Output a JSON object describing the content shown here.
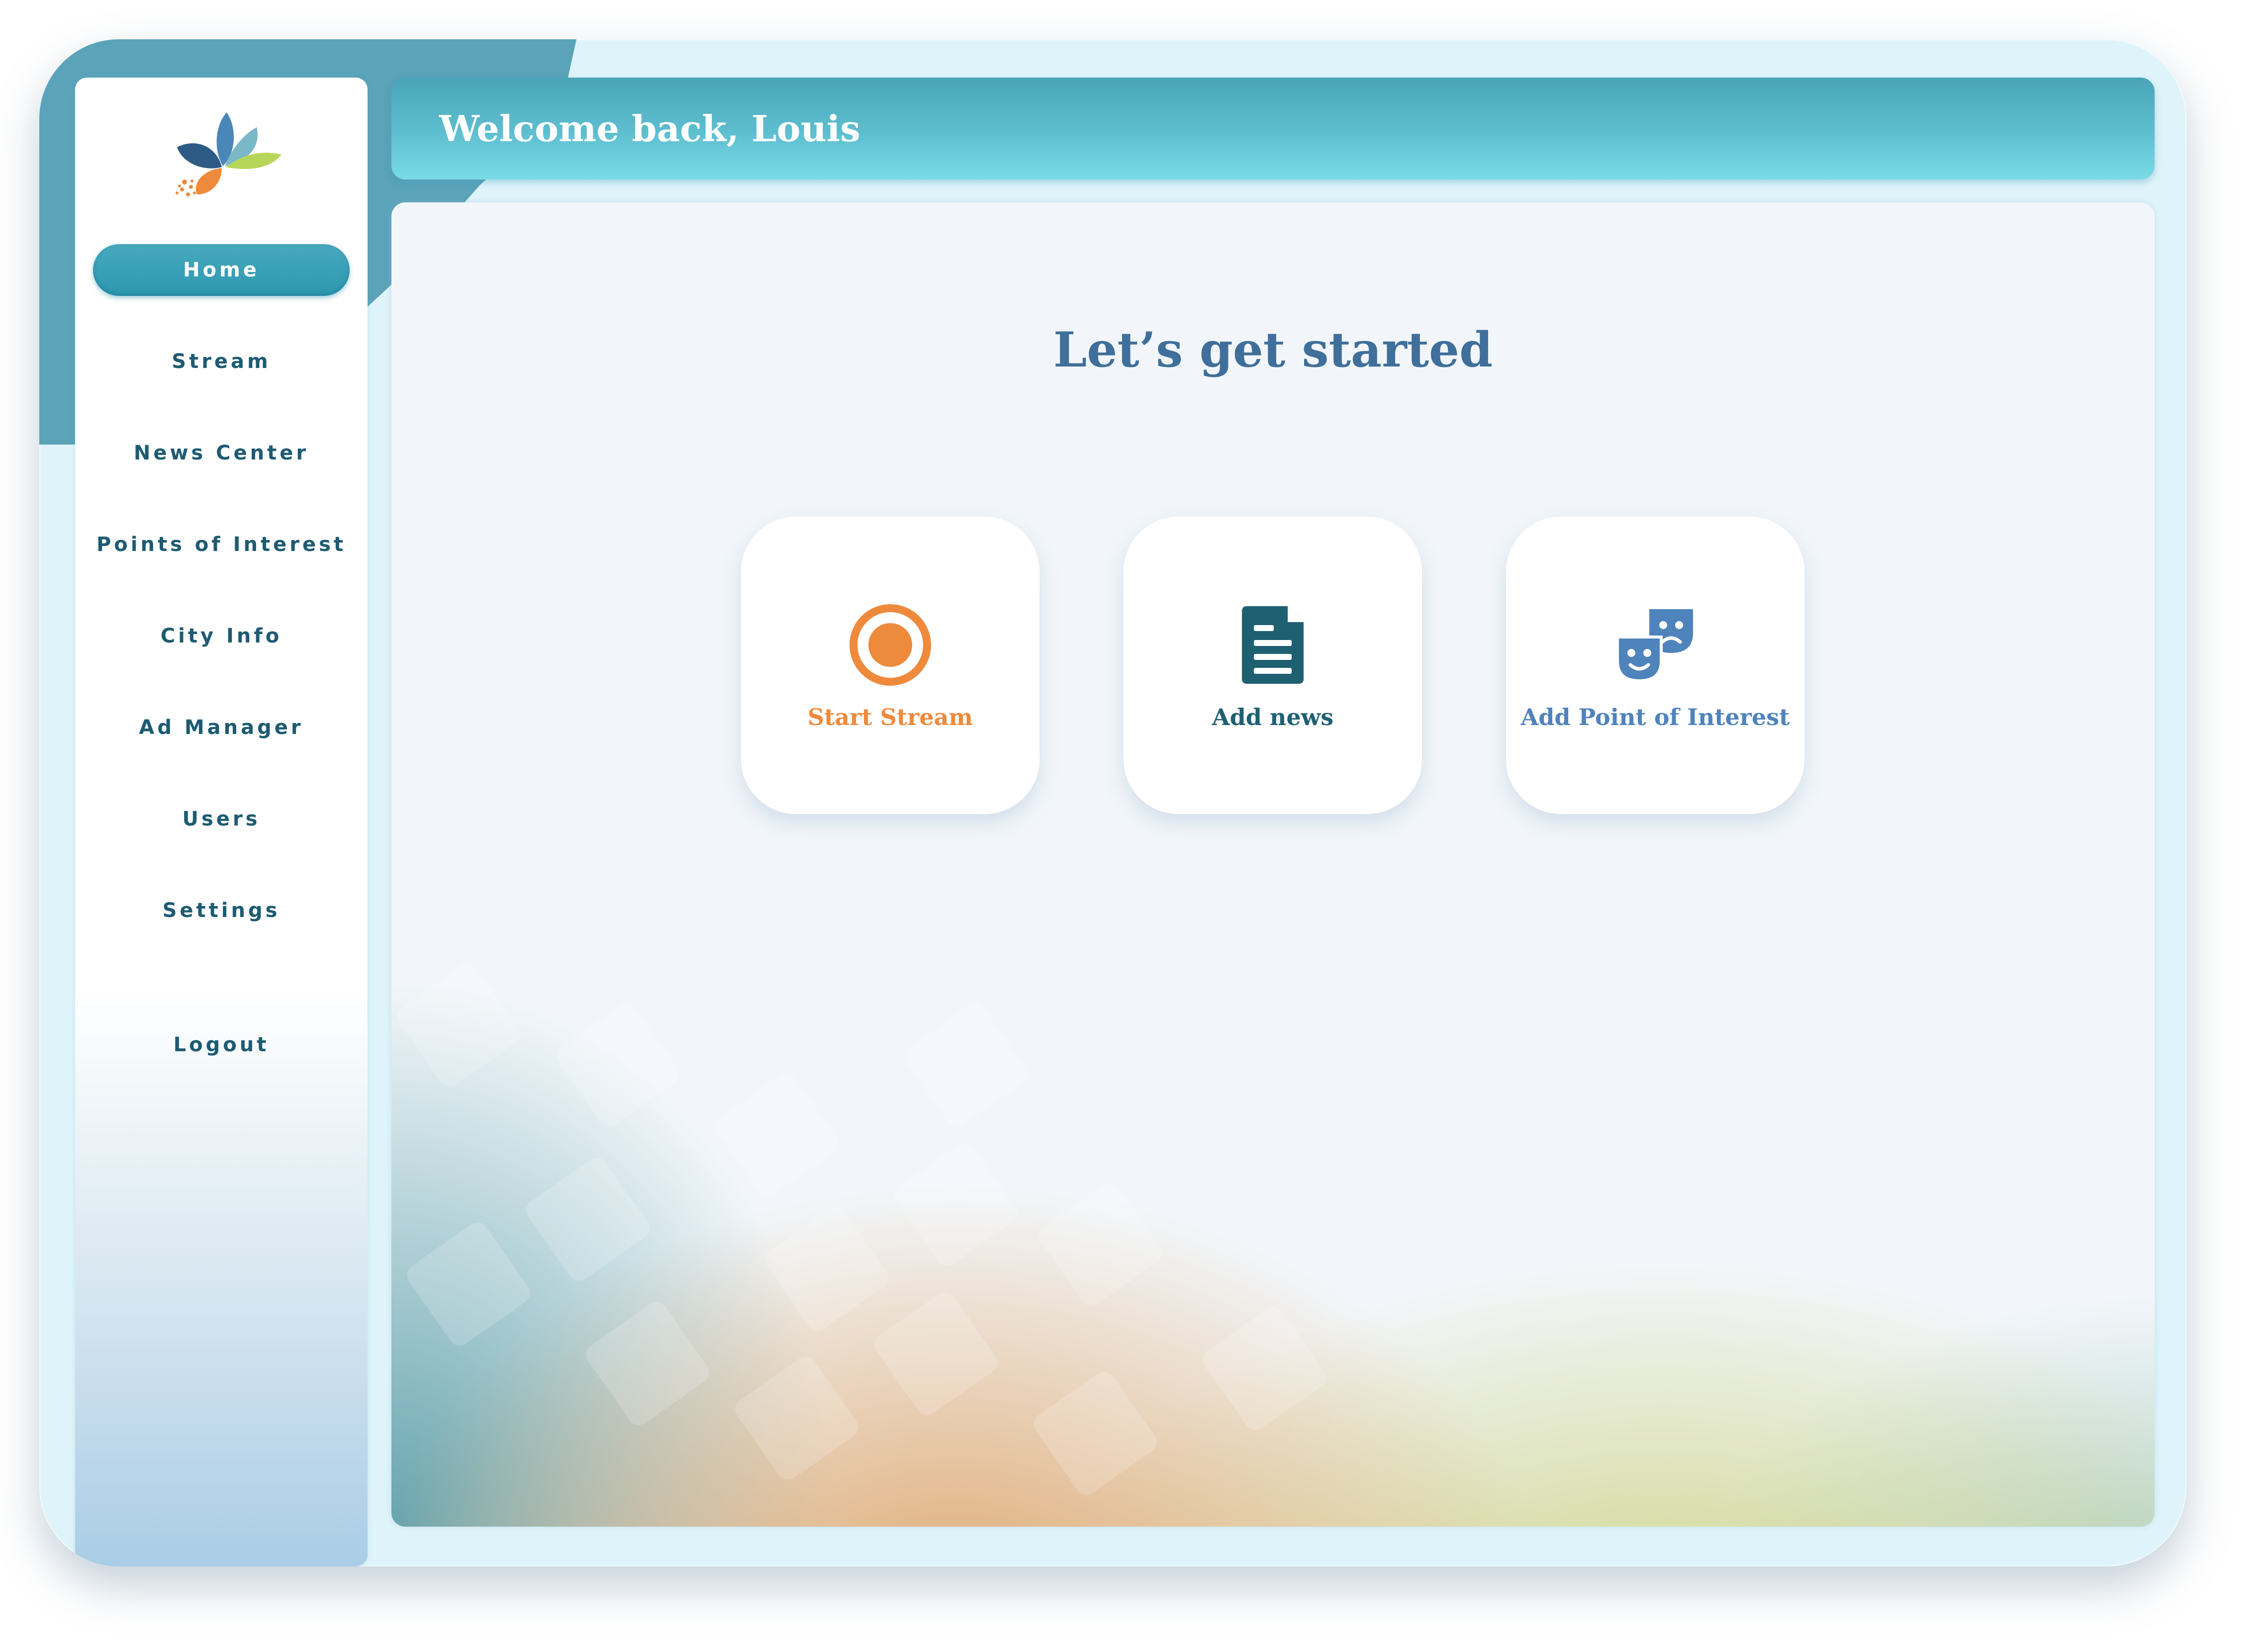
{
  "app": {
    "logo_icon": "petal-logo-icon"
  },
  "header": {
    "greeting": "Welcome back, Louis"
  },
  "sidebar": {
    "items": [
      {
        "label": "Home",
        "active": true
      },
      {
        "label": "Stream"
      },
      {
        "label": "News Center"
      },
      {
        "label": "Points of Interest"
      },
      {
        "label": "City Info"
      },
      {
        "label": "Ad Manager"
      },
      {
        "label": "Users"
      },
      {
        "label": "Settings"
      }
    ],
    "logout_label": "Logout"
  },
  "main": {
    "headline": "Let’s get started",
    "actions": [
      {
        "label": "Start Stream",
        "icon": "record-icon",
        "color": "#ee8a3c"
      },
      {
        "label": "Add news",
        "icon": "news-document-icon",
        "color": "#1f5f72"
      },
      {
        "label": "Add Point of Interest",
        "icon": "theater-masks-icon",
        "color": "#4f83bc"
      }
    ]
  },
  "colors": {
    "accent": "#4aa4b8",
    "nav_text": "#1e5b72",
    "headline": "#3f6f9a"
  }
}
